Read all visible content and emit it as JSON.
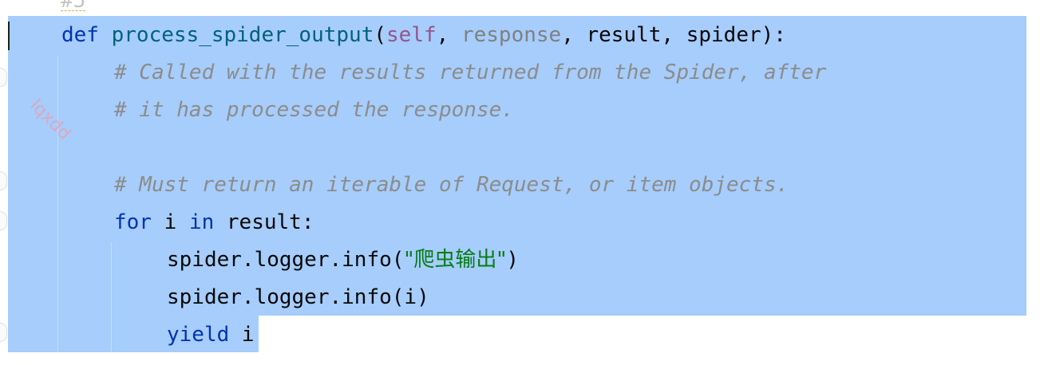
{
  "editor": {
    "faded_line": "#5",
    "watermark": "lqxdd",
    "lines": {
      "def_kw": "def",
      "func_name": "process_spider_output",
      "paren_open": "(",
      "self_param": "self",
      "comma1": ", ",
      "response_param": "response",
      "rest_params": ", result, spider):",
      "comment1": "# Called with the results returned from the Spider, after",
      "comment2": "# it has processed the response.",
      "comment3": "# Must return an iterable of Request, or item objects.",
      "for_kw": "for",
      "for_var": " i ",
      "in_kw": "in",
      "for_rest": " result:",
      "log1_pre": "spider.logger.info(",
      "log1_str": "\"爬虫输出\"",
      "log1_post": ")",
      "log2": "spider.logger.info(i)",
      "yield_kw": "yield",
      "yield_var": " i"
    }
  }
}
